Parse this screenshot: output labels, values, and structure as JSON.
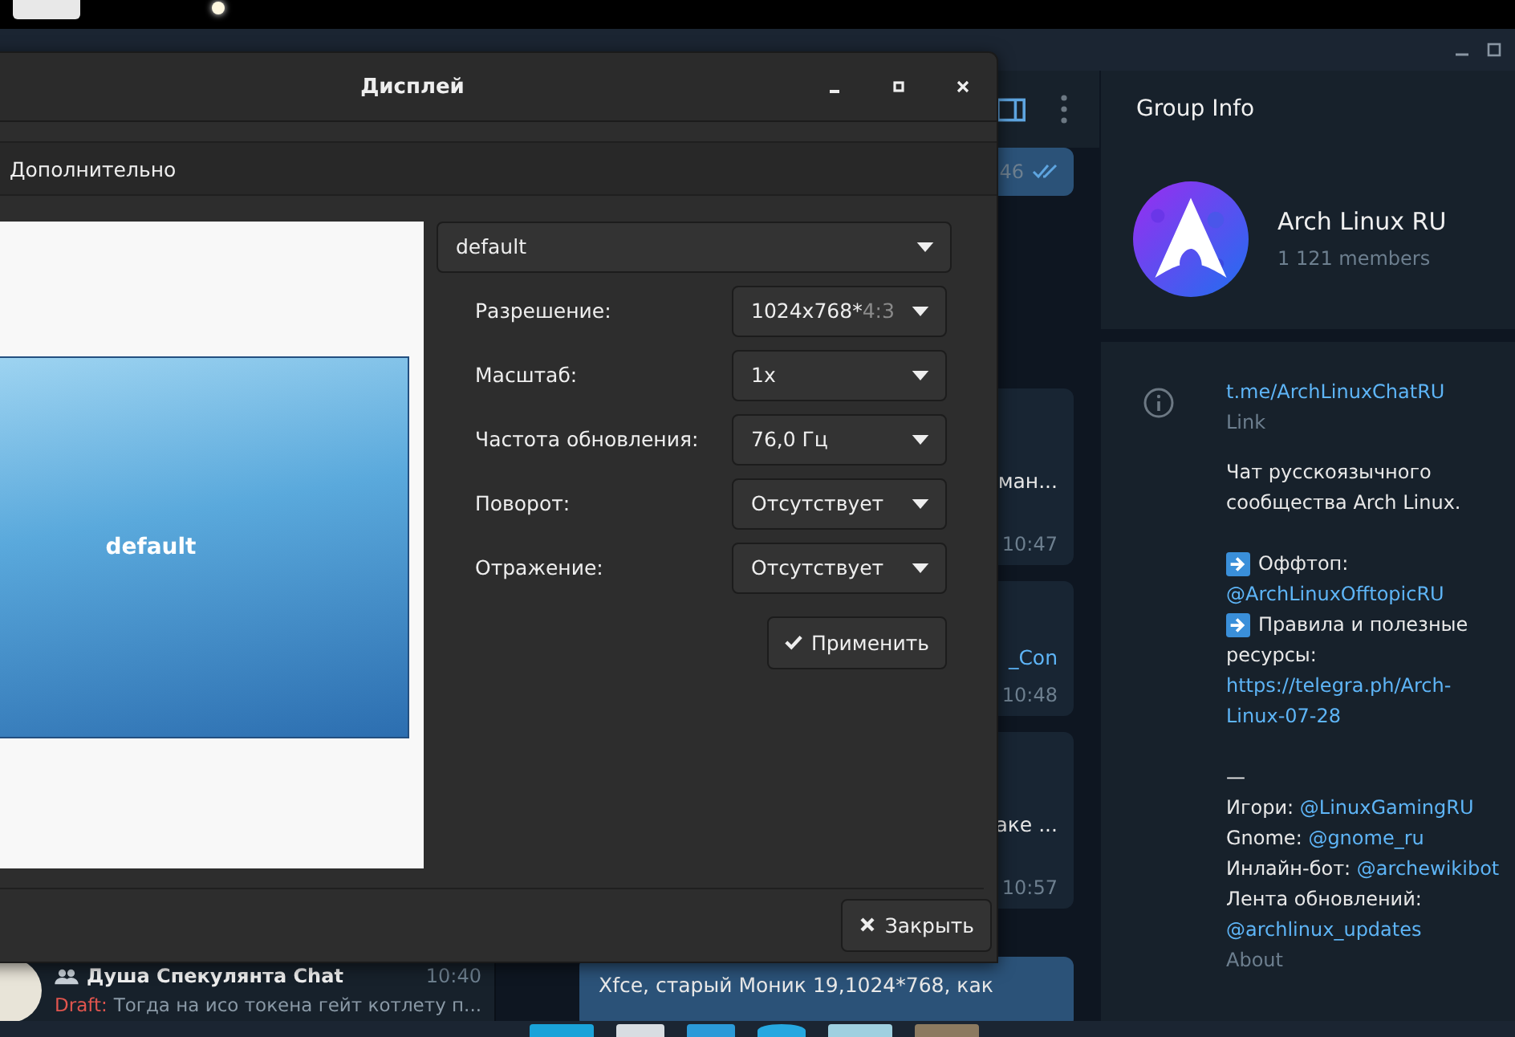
{
  "dialog": {
    "title": "Дисплей",
    "tab": "Дополнительно",
    "preview": {
      "monitor_label": "default"
    },
    "monitor_select": "default",
    "settings": [
      {
        "label": "Разрешение:",
        "value": "1024x768*",
        "note": "4:3"
      },
      {
        "label": "Масштаб:",
        "value": "1x"
      },
      {
        "label": "Частота обновления:",
        "value": "76,0 Гц"
      },
      {
        "label": "Поворот:",
        "value": "Отсутствует"
      },
      {
        "label": "Отражение:",
        "value": "Отсутствует"
      }
    ],
    "apply_button": "Применить",
    "close_button": "Закрыть"
  },
  "chat": {
    "messages": [
      {
        "kind": "outgoing",
        "time": "46"
      },
      {
        "kind": "incoming",
        "text": "ман...",
        "time": "10:47"
      },
      {
        "kind": "incoming",
        "link": "_Con",
        "time": "10:48"
      },
      {
        "kind": "incoming",
        "text": "аке ...",
        "time": "10:57"
      }
    ],
    "last_message": "Xfce, старый Моник 19,1024*768, как"
  },
  "chat_list": {
    "item": {
      "name": "Душа Спекулянта Chat",
      "time": "10:40",
      "draft_label": "Draft:",
      "preview": "Тогда на исо токена гейт котлету п..."
    }
  },
  "group_info": {
    "header": "Group Info",
    "name": "Arch Linux RU",
    "members": "1 121 members",
    "link": "t.me/ArchLinuxChatRU",
    "link_caption": "Link",
    "description": [
      {
        "kind": "text",
        "text": "Чат русскоязычного"
      },
      {
        "kind": "text",
        "text": "сообщества Arch Linux."
      },
      {
        "kind": "blank"
      },
      {
        "kind": "arrow",
        "text": "Оффтоп:"
      },
      {
        "kind": "link",
        "link": "@ArchLinuxOfftopicRU"
      },
      {
        "kind": "arrow",
        "text": "Правила и полезные"
      },
      {
        "kind": "text",
        "text": "ресурсы:"
      },
      {
        "kind": "link",
        "link": "https://telegra.ph/Arch-"
      },
      {
        "kind": "link",
        "link": "Linux-07-28"
      },
      {
        "kind": "blank"
      },
      {
        "kind": "text",
        "text": "—"
      },
      {
        "kind": "text",
        "text": "Игори: ",
        "link": "@LinuxGamingRU"
      },
      {
        "kind": "text",
        "text": "Gnome: ",
        "link": "@gnome_ru"
      },
      {
        "kind": "text",
        "text": "Инлайн-бот: ",
        "link": "@archewikibot"
      },
      {
        "kind": "text",
        "text": "Лента обновлений:"
      },
      {
        "kind": "link",
        "link": "@archlinux_updates"
      }
    ],
    "description_caption": "About"
  }
}
